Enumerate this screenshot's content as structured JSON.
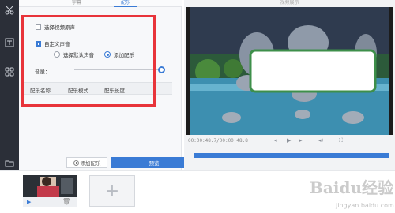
{
  "tabs": {
    "left_tab": "字幕",
    "right_tab": "配乐"
  },
  "options": {
    "original_sound": {
      "label": "选择视频原声",
      "checked": false
    },
    "custom_sound": {
      "label": "自定义声音",
      "checked": true
    },
    "default_sound": {
      "label": "选择默认声音",
      "selected": false
    },
    "add_music": {
      "label": "添加配乐",
      "selected": true
    }
  },
  "volume": {
    "label": "音量：",
    "level": 1.0
  },
  "music_table": {
    "columns": [
      "配乐名称",
      "配乐模式",
      "配乐长度"
    ]
  },
  "buttons": {
    "add_music": "添加配乐",
    "preview": "预览"
  },
  "preview": {
    "title": "视频展示",
    "time": "00:00:48.7/00:00:48.8"
  },
  "accent_color": "#3a7bd5",
  "highlight_color": "#e8343a",
  "watermark": {
    "text": "Baidu经验",
    "sub": "jingyan.baidu.com"
  }
}
